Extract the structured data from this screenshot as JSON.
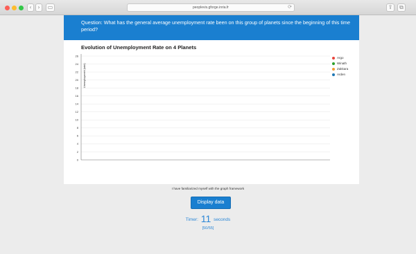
{
  "browser": {
    "address": "peoplevis.gforge.inria.fr",
    "reload_glyph": "⟳",
    "back_glyph": "‹",
    "forward_glyph": "›",
    "sidebar_glyph": "▭",
    "share_glyph": "⇪",
    "tabs_glyph": "⧉"
  },
  "question": {
    "text": "Question: What has the general average unemployment rate been on this group of planets since the beginning of this time period?"
  },
  "chart_data": {
    "type": "line",
    "title": "Evolution of Unemployment Rate on 4 Planets",
    "ylabel": "Unemployment (rate)",
    "xlabel": "",
    "ylim": [
      0,
      26
    ],
    "yticks": [
      "0",
      "2",
      "4",
      "6",
      "8",
      "10",
      "12",
      "14",
      "16",
      "18",
      "20",
      "22",
      "24",
      "26"
    ],
    "grid": true,
    "legend_position": "top-right",
    "series": [
      {
        "name": "Argo",
        "color": "#e8453c",
        "values": []
      },
      {
        "name": "Winath",
        "color": "#2ca02c",
        "values": []
      },
      {
        "name": "Zakkara",
        "color": "#f39c34",
        "values": []
      },
      {
        "name": "Arden",
        "color": "#1f77b4",
        "values": []
      }
    ]
  },
  "familiar_text": "I have familiarized myself with the graph framework",
  "display_button": "Display data",
  "timer": {
    "label": "Timer:",
    "value": "11",
    "unit": "seconds"
  },
  "progress": "[50/55]"
}
